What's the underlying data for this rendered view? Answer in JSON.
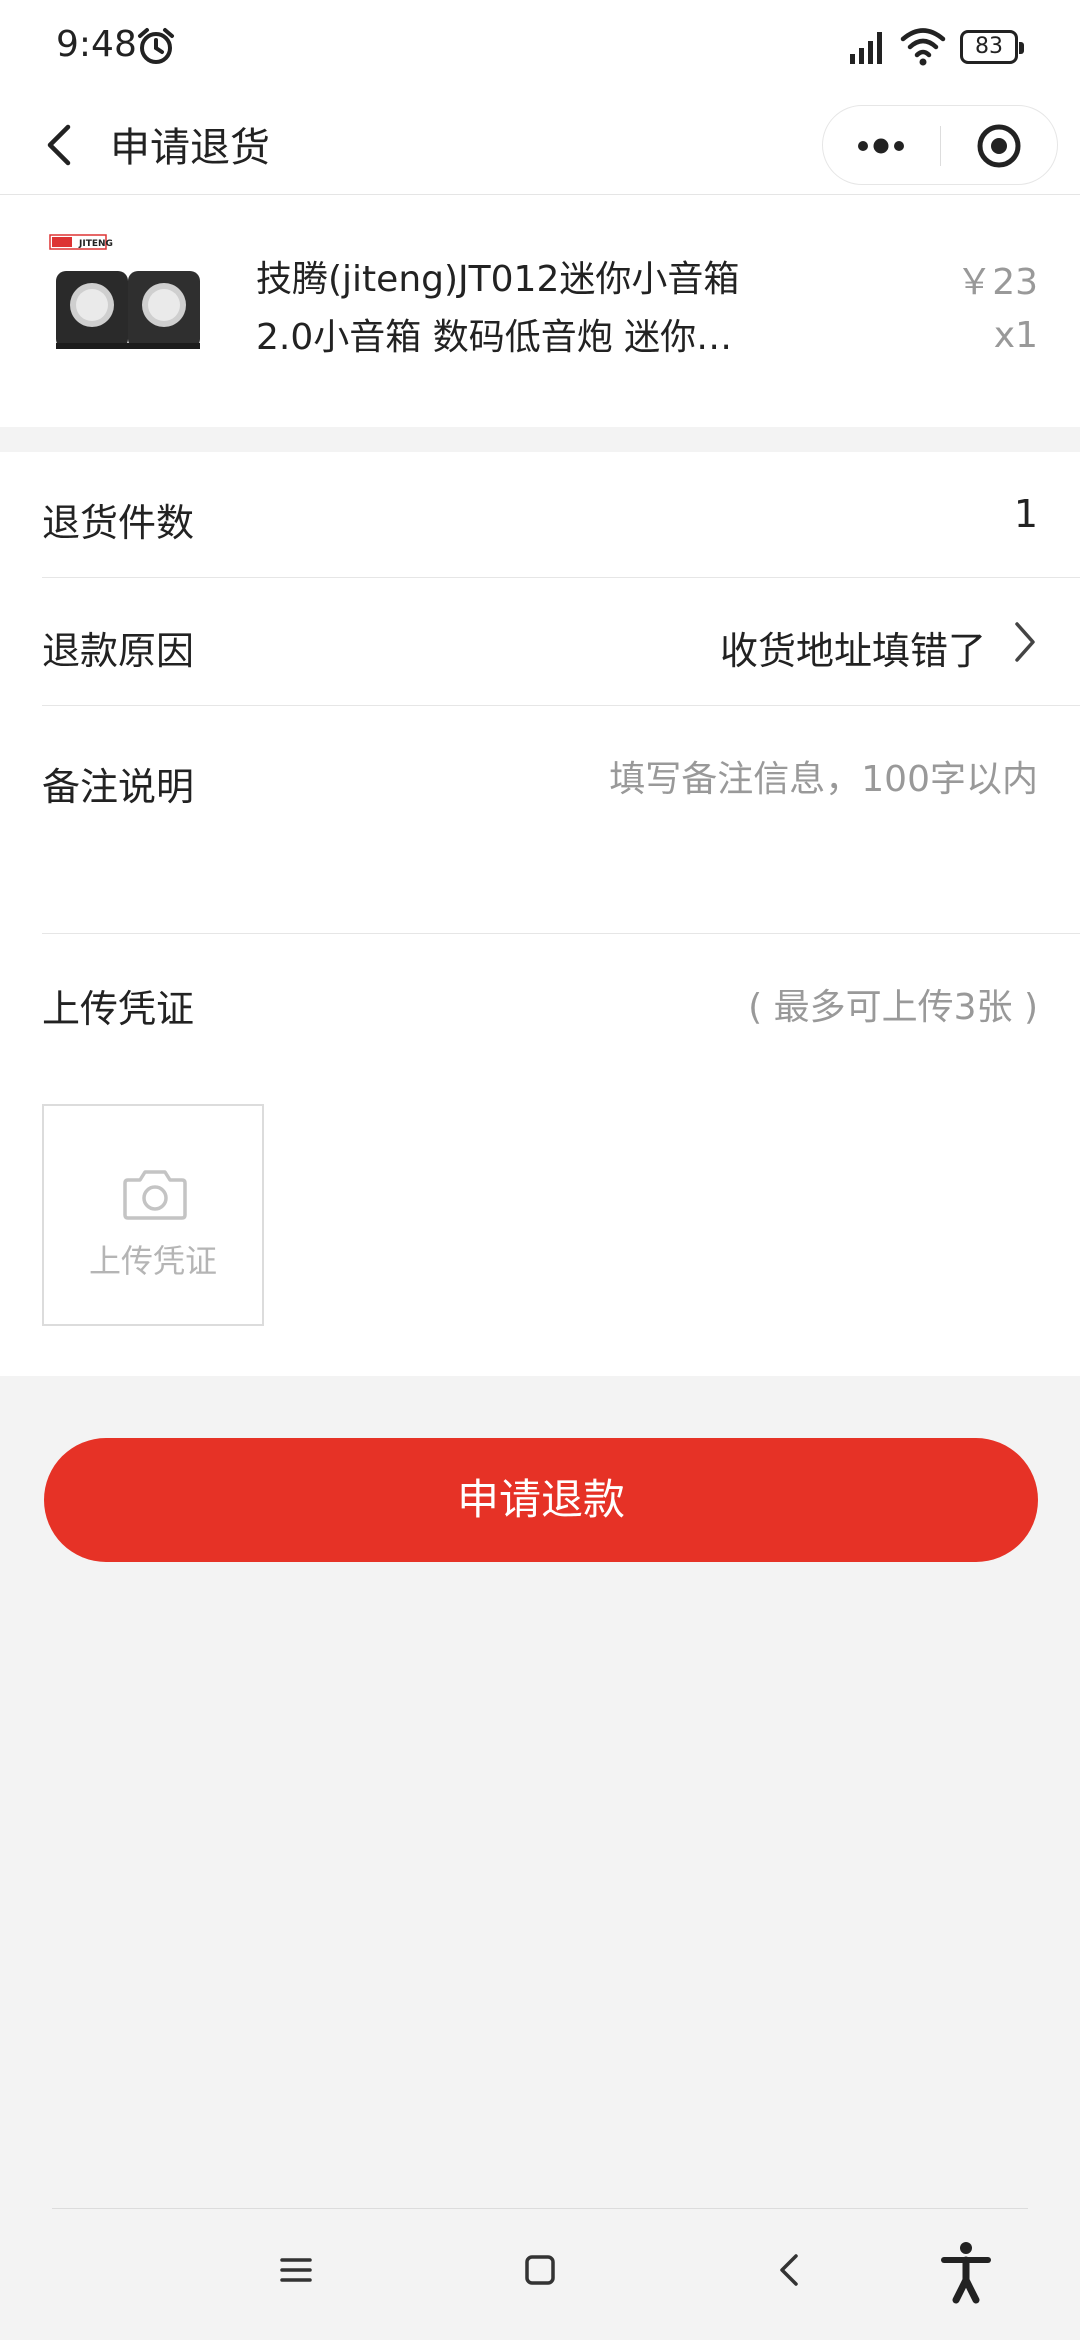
{
  "status_bar": {
    "time": "9:48",
    "battery": "83"
  },
  "navbar": {
    "title": "申请退货"
  },
  "product": {
    "title": "技腾(jiteng)JT012迷你小音箱2.0小音箱 数码低音炮 迷你…",
    "price": "￥23",
    "quantity": "x1",
    "image_brand": "技腾 JITENG"
  },
  "form": {
    "return_count_label": "退货件数",
    "return_count_value": "1",
    "refund_reason_label": "退款原因",
    "refund_reason_value": "收货地址填错了",
    "remark_label": "备注说明",
    "remark_placeholder": "填写备注信息，100字以内",
    "upload_label": "上传凭证",
    "upload_hint": "( 最多可上传3张 )",
    "upload_box_label": "上传凭证"
  },
  "submit_label": "申请退款",
  "colors": {
    "accent": "#e63226",
    "page_bg": "#f3f3f3",
    "placeholder": "#999999"
  }
}
